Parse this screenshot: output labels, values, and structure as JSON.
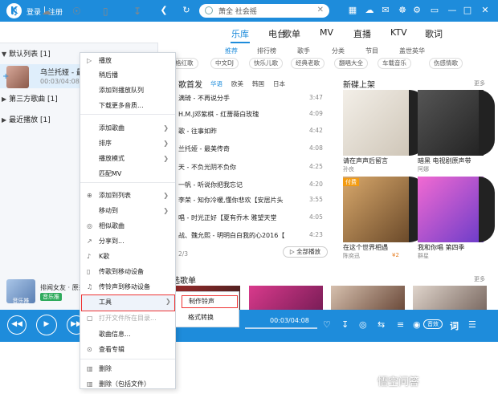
{
  "app": {
    "logo": "K",
    "login": "登录",
    "sep": "|",
    "register": "注册",
    "search_value": "萧全 社会摇",
    "colors": {
      "accent": "#1e8cdb",
      "highlight": "#e33333"
    }
  },
  "left": {
    "groups": [
      {
        "label": "默认列表 [1]"
      },
      {
        "label": "第三方歌曲 [1]"
      },
      {
        "label": "最近播放 [1]"
      }
    ],
    "now_title": "乌兰托娅 - 最",
    "now_time": "00:03/04:08",
    "mini_title": "排闻女友 · 原来",
    "mini_art": "音乐推",
    "mini_badge": "音乐推"
  },
  "nav": {
    "tabs": [
      "乐库",
      "电台",
      "歌单",
      "MV",
      "直播",
      "KTV",
      "歌词"
    ],
    "subtabs": [
      "推荐",
      "排行榜",
      "歌手",
      "分类",
      "节目",
      "盖世英华"
    ],
    "chips": [
      "格红歌",
      "中文DJ",
      "快乐儿歌",
      "经典老歌",
      "翻唱大全",
      "车载音乐",
      "伤感情歌"
    ]
  },
  "first": {
    "title": "歌首发",
    "tabs": [
      "华语",
      "欧美",
      "韩国",
      "日本"
    ],
    "songs": [
      {
        "name": "满琦 - 不再说分手",
        "dur": "3:47"
      },
      {
        "name": "H.M.J邓紫棋 - 红蔷薇白玫瑰",
        "dur": "4:09"
      },
      {
        "name": "歌 - 往事如昨",
        "dur": "4:42"
      },
      {
        "name": "兰托娅 - 最美传奇",
        "dur": "4:08"
      },
      {
        "name": "天 - 不负光阴不负你",
        "dur": "4:25"
      },
      {
        "name": "一帆 - 听说你把我忘记",
        "dur": "4:20"
      },
      {
        "name": "李荣 - 知你冷暖,懂你悲欢【安居片头",
        "dur": "3:55"
      },
      {
        "name": "唱 - 时光正好【夏有乔木 雅望天堂",
        "dur": "4:05"
      },
      {
        "name": "战、魏允熙 - 明明白白我的心2016【",
        "dur": "4:23"
      }
    ],
    "pager": "2/3",
    "play_all": "全部播放"
  },
  "newalbums": {
    "title": "新碟上架",
    "more": "更多",
    "items": [
      {
        "cap": "请在声声后留言",
        "sub": "孙良"
      },
      {
        "cap": "暗黑 电视剧原声带",
        "sub": "阿娜"
      },
      {
        "cap": "在这个世界相遇",
        "sub": "陈奕迅",
        "price": "¥2"
      },
      {
        "cap": "我和你唱 第四季",
        "sub": "群星"
      }
    ],
    "badge": "付费"
  },
  "recommend": {
    "title": "选歌单",
    "more": "更多"
  },
  "player": {
    "time": "00:03/04:08",
    "quality": "音效",
    "lyric_btn": "词"
  },
  "menu": {
    "items": [
      {
        "label": "播放"
      },
      {
        "label": "稍后播"
      },
      {
        "label": "添加到播放队列"
      },
      {
        "label": "下载更多音质..."
      },
      {
        "label": "添加歌曲"
      },
      {
        "label": "排序"
      },
      {
        "label": "播放模式"
      },
      {
        "label": "匹配MV"
      },
      {
        "label": "添加到列表"
      },
      {
        "label": "移动到"
      },
      {
        "label": "相似歌曲"
      },
      {
        "label": "分享到..."
      },
      {
        "label": "K歌"
      },
      {
        "label": "传歌到移动设备"
      },
      {
        "label": "传铃声到移动设备"
      },
      {
        "label": "工具"
      },
      {
        "label": "打开文件所在目录..."
      },
      {
        "label": "歌曲信息..."
      },
      {
        "label": "查看专辑"
      },
      {
        "label": "删除"
      },
      {
        "label": "删除（包括文件）"
      }
    ],
    "submenu": [
      "制作铃声",
      "格式转换"
    ]
  },
  "watermark": "悟空问答"
}
